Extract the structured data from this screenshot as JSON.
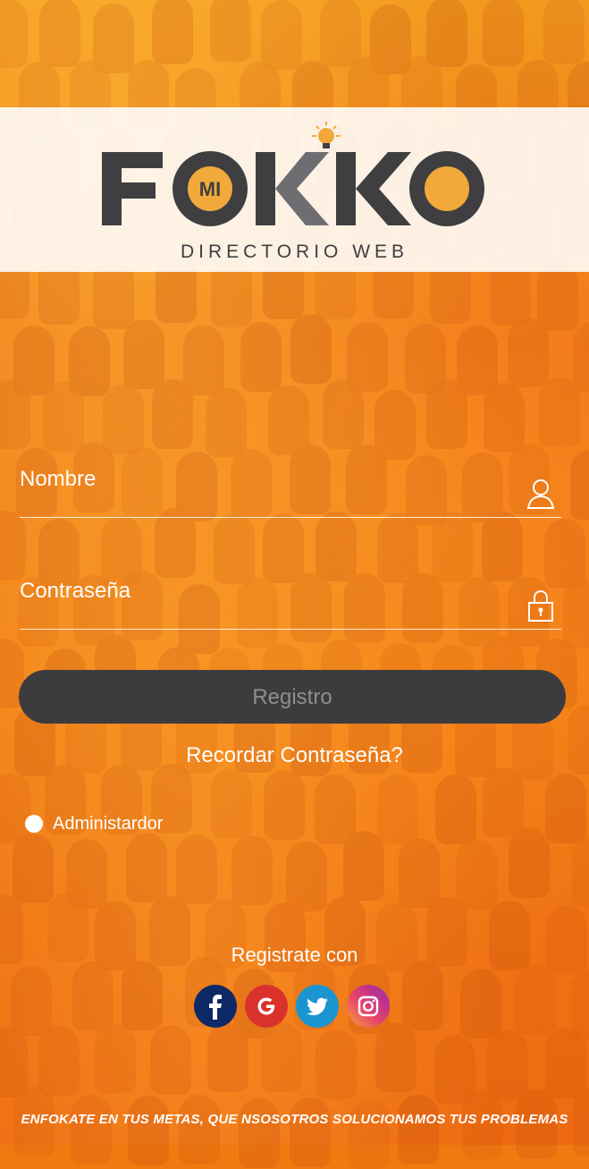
{
  "brand": {
    "logo_prefix": "MI",
    "logo_letters_1": "FO",
    "logo_letters_2": "KKO",
    "subtitle": "DIRECTORIO WEB"
  },
  "form": {
    "name_label": "Nombre",
    "password_label": "Contraseña",
    "register_button": "Registro",
    "forgot_link": "Recordar Contraseña?",
    "admin_radio_label": "Administardor"
  },
  "social": {
    "heading": "Registrate con",
    "items": [
      {
        "name": "facebook",
        "icon": "facebook-icon",
        "color": "#0e2a66"
      },
      {
        "name": "google",
        "icon": "google-icon",
        "color": "#d9322c"
      },
      {
        "name": "twitter",
        "icon": "twitter-icon",
        "color": "#1a95d2"
      },
      {
        "name": "instagram",
        "icon": "instagram-icon",
        "color": "#c13584"
      }
    ]
  },
  "footer": {
    "tagline": "ENFOKATE EN TUS METAS, QUE NSOSOTROS SOLUCIONAMOS TUS PROBLEMAS"
  },
  "colors": {
    "background": "#f07a10",
    "logo_dark": "#3f3f41",
    "logo_accent": "#f2a93b",
    "button": "#3c3c3e"
  }
}
